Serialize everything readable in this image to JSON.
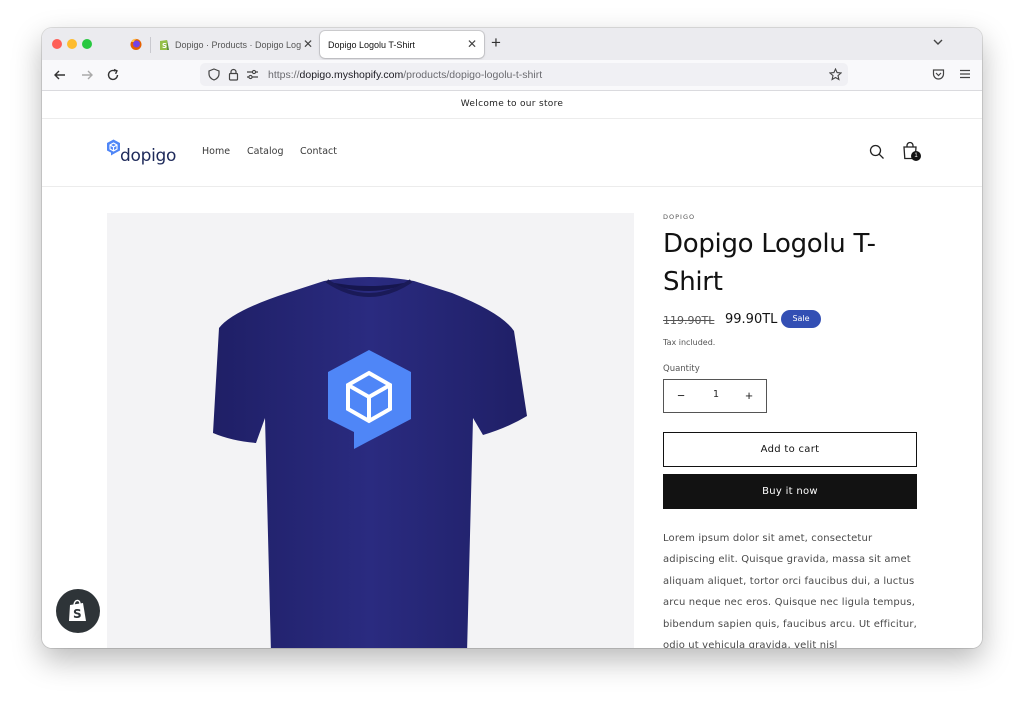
{
  "browser": {
    "tabs": [
      {
        "title": "Dopigo · Products · Dopigo Logolu T-Shirt",
        "active": false
      },
      {
        "title": "Dopigo Logolu T-Shirt",
        "active": true
      }
    ],
    "url": {
      "prefix": "https://",
      "domain": "dopigo.myshopify.com",
      "path": "/products/dopigo-logolu-t-shirt"
    }
  },
  "store": {
    "announcement": "Welcome to our store",
    "logo_text": "dopigo",
    "menu": [
      "Home",
      "Catalog",
      "Contact"
    ],
    "cart_count": "1"
  },
  "product": {
    "vendor": "DOPIGO",
    "title": "Dopigo Logolu T-Shirt",
    "price_regular": "119.90TL",
    "price_sale": "99.90TL",
    "sale_badge": "Sale",
    "tax_note": "Tax included.",
    "quantity_label": "Quantity",
    "quantity_value": "1",
    "add_to_cart": "Add to cart",
    "buy_now": "Buy it now",
    "description": "Lorem ipsum dolor sit amet, consectetur adipiscing elit. Quisque gravida, massa sit amet aliquam aliquet, tortor orci faucibus dui, a luctus arcu neque nec eros. Quisque nec ligula tempus, bibendum sapien quis, faucibus arcu. Ut efficitur, odio ut vehicula gravida, velit nisl"
  },
  "colors": {
    "tshirt": "#27287a",
    "logo_blue": "#4f86f7",
    "sale_badge": "#334fb4",
    "buy_button": "#121212"
  }
}
